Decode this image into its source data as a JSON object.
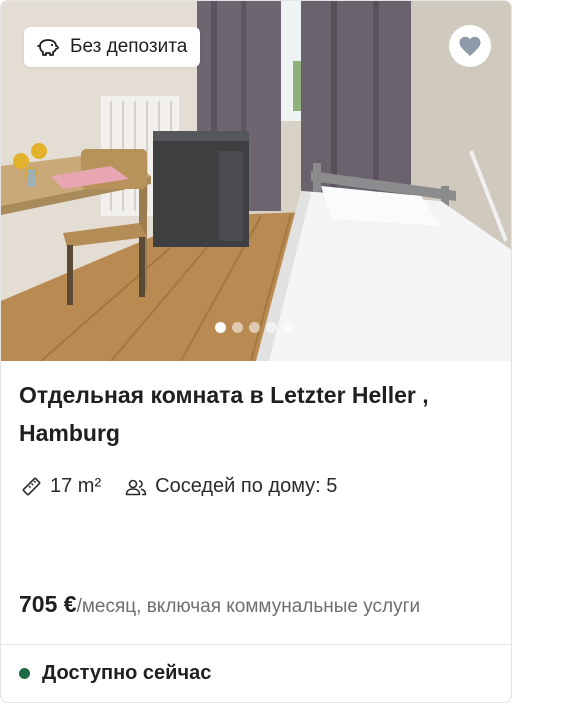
{
  "listing": {
    "badge": {
      "text": "Без депозита",
      "icon": "piggy-bank-icon"
    },
    "favorite": {
      "icon": "heart-icon"
    },
    "photos": {
      "count": 5,
      "active_index": 0
    },
    "title": "Отдельная комната в Letzter Heller , Hamburg",
    "area": {
      "icon": "ruler-icon",
      "text": "17 m²"
    },
    "flatmates": {
      "icon": "people-icon",
      "text": "Соседей по дому: 5"
    },
    "price": {
      "amount": "705 €",
      "suffix": "/месяц, включая коммунальные услуги"
    },
    "availability": {
      "text": "Доступно сейчас",
      "color": "#1f6b45"
    }
  }
}
